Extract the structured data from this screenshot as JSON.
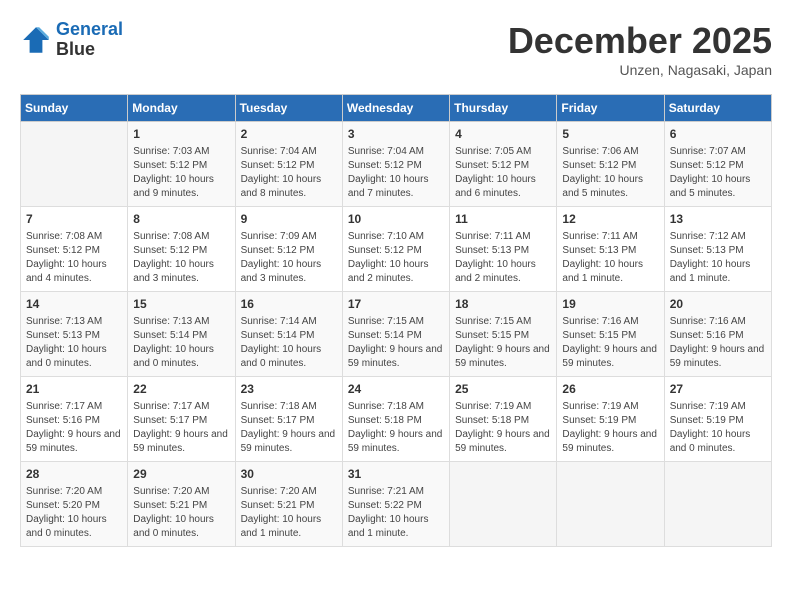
{
  "header": {
    "logo_line1": "General",
    "logo_line2": "Blue",
    "month_title": "December 2025",
    "subtitle": "Unzen, Nagasaki, Japan"
  },
  "weekdays": [
    "Sunday",
    "Monday",
    "Tuesday",
    "Wednesday",
    "Thursday",
    "Friday",
    "Saturday"
  ],
  "weeks": [
    [
      {
        "day": "",
        "sunrise": "",
        "sunset": "",
        "daylight": ""
      },
      {
        "day": "1",
        "sunrise": "Sunrise: 7:03 AM",
        "sunset": "Sunset: 5:12 PM",
        "daylight": "Daylight: 10 hours and 9 minutes."
      },
      {
        "day": "2",
        "sunrise": "Sunrise: 7:04 AM",
        "sunset": "Sunset: 5:12 PM",
        "daylight": "Daylight: 10 hours and 8 minutes."
      },
      {
        "day": "3",
        "sunrise": "Sunrise: 7:04 AM",
        "sunset": "Sunset: 5:12 PM",
        "daylight": "Daylight: 10 hours and 7 minutes."
      },
      {
        "day": "4",
        "sunrise": "Sunrise: 7:05 AM",
        "sunset": "Sunset: 5:12 PM",
        "daylight": "Daylight: 10 hours and 6 minutes."
      },
      {
        "day": "5",
        "sunrise": "Sunrise: 7:06 AM",
        "sunset": "Sunset: 5:12 PM",
        "daylight": "Daylight: 10 hours and 5 minutes."
      },
      {
        "day": "6",
        "sunrise": "Sunrise: 7:07 AM",
        "sunset": "Sunset: 5:12 PM",
        "daylight": "Daylight: 10 hours and 5 minutes."
      }
    ],
    [
      {
        "day": "7",
        "sunrise": "Sunrise: 7:08 AM",
        "sunset": "Sunset: 5:12 PM",
        "daylight": "Daylight: 10 hours and 4 minutes."
      },
      {
        "day": "8",
        "sunrise": "Sunrise: 7:08 AM",
        "sunset": "Sunset: 5:12 PM",
        "daylight": "Daylight: 10 hours and 3 minutes."
      },
      {
        "day": "9",
        "sunrise": "Sunrise: 7:09 AM",
        "sunset": "Sunset: 5:12 PM",
        "daylight": "Daylight: 10 hours and 3 minutes."
      },
      {
        "day": "10",
        "sunrise": "Sunrise: 7:10 AM",
        "sunset": "Sunset: 5:12 PM",
        "daylight": "Daylight: 10 hours and 2 minutes."
      },
      {
        "day": "11",
        "sunrise": "Sunrise: 7:11 AM",
        "sunset": "Sunset: 5:13 PM",
        "daylight": "Daylight: 10 hours and 2 minutes."
      },
      {
        "day": "12",
        "sunrise": "Sunrise: 7:11 AM",
        "sunset": "Sunset: 5:13 PM",
        "daylight": "Daylight: 10 hours and 1 minute."
      },
      {
        "day": "13",
        "sunrise": "Sunrise: 7:12 AM",
        "sunset": "Sunset: 5:13 PM",
        "daylight": "Daylight: 10 hours and 1 minute."
      }
    ],
    [
      {
        "day": "14",
        "sunrise": "Sunrise: 7:13 AM",
        "sunset": "Sunset: 5:13 PM",
        "daylight": "Daylight: 10 hours and 0 minutes."
      },
      {
        "day": "15",
        "sunrise": "Sunrise: 7:13 AM",
        "sunset": "Sunset: 5:14 PM",
        "daylight": "Daylight: 10 hours and 0 minutes."
      },
      {
        "day": "16",
        "sunrise": "Sunrise: 7:14 AM",
        "sunset": "Sunset: 5:14 PM",
        "daylight": "Daylight: 10 hours and 0 minutes."
      },
      {
        "day": "17",
        "sunrise": "Sunrise: 7:15 AM",
        "sunset": "Sunset: 5:14 PM",
        "daylight": "Daylight: 9 hours and 59 minutes."
      },
      {
        "day": "18",
        "sunrise": "Sunrise: 7:15 AM",
        "sunset": "Sunset: 5:15 PM",
        "daylight": "Daylight: 9 hours and 59 minutes."
      },
      {
        "day": "19",
        "sunrise": "Sunrise: 7:16 AM",
        "sunset": "Sunset: 5:15 PM",
        "daylight": "Daylight: 9 hours and 59 minutes."
      },
      {
        "day": "20",
        "sunrise": "Sunrise: 7:16 AM",
        "sunset": "Sunset: 5:16 PM",
        "daylight": "Daylight: 9 hours and 59 minutes."
      }
    ],
    [
      {
        "day": "21",
        "sunrise": "Sunrise: 7:17 AM",
        "sunset": "Sunset: 5:16 PM",
        "daylight": "Daylight: 9 hours and 59 minutes."
      },
      {
        "day": "22",
        "sunrise": "Sunrise: 7:17 AM",
        "sunset": "Sunset: 5:17 PM",
        "daylight": "Daylight: 9 hours and 59 minutes."
      },
      {
        "day": "23",
        "sunrise": "Sunrise: 7:18 AM",
        "sunset": "Sunset: 5:17 PM",
        "daylight": "Daylight: 9 hours and 59 minutes."
      },
      {
        "day": "24",
        "sunrise": "Sunrise: 7:18 AM",
        "sunset": "Sunset: 5:18 PM",
        "daylight": "Daylight: 9 hours and 59 minutes."
      },
      {
        "day": "25",
        "sunrise": "Sunrise: 7:19 AM",
        "sunset": "Sunset: 5:18 PM",
        "daylight": "Daylight: 9 hours and 59 minutes."
      },
      {
        "day": "26",
        "sunrise": "Sunrise: 7:19 AM",
        "sunset": "Sunset: 5:19 PM",
        "daylight": "Daylight: 9 hours and 59 minutes."
      },
      {
        "day": "27",
        "sunrise": "Sunrise: 7:19 AM",
        "sunset": "Sunset: 5:19 PM",
        "daylight": "Daylight: 10 hours and 0 minutes."
      }
    ],
    [
      {
        "day": "28",
        "sunrise": "Sunrise: 7:20 AM",
        "sunset": "Sunset: 5:20 PM",
        "daylight": "Daylight: 10 hours and 0 minutes."
      },
      {
        "day": "29",
        "sunrise": "Sunrise: 7:20 AM",
        "sunset": "Sunset: 5:21 PM",
        "daylight": "Daylight: 10 hours and 0 minutes."
      },
      {
        "day": "30",
        "sunrise": "Sunrise: 7:20 AM",
        "sunset": "Sunset: 5:21 PM",
        "daylight": "Daylight: 10 hours and 1 minute."
      },
      {
        "day": "31",
        "sunrise": "Sunrise: 7:21 AM",
        "sunset": "Sunset: 5:22 PM",
        "daylight": "Daylight: 10 hours and 1 minute."
      },
      {
        "day": "",
        "sunrise": "",
        "sunset": "",
        "daylight": ""
      },
      {
        "day": "",
        "sunrise": "",
        "sunset": "",
        "daylight": ""
      },
      {
        "day": "",
        "sunrise": "",
        "sunset": "",
        "daylight": ""
      }
    ]
  ]
}
